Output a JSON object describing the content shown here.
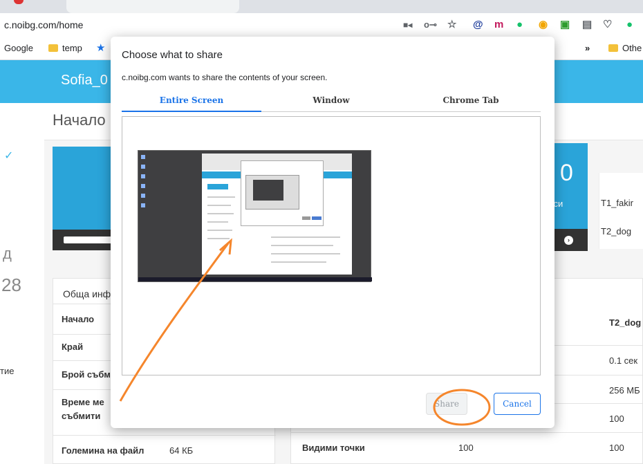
{
  "browser": {
    "url": "c.noibg.com/home",
    "bookmarks": [
      "Google",
      "temp",
      "»",
      "Othe"
    ]
  },
  "page": {
    "site_name": "Sofia_0",
    "breadcrumb": "Начало",
    "left_fragments": [
      "д",
      "28",
      "тие"
    ],
    "blue_count": "0",
    "blue_label": "роси",
    "side_items": [
      "T1_fakir",
      "T2_dog"
    ],
    "info_header": "Обща инф",
    "info_rows": [
      {
        "key": "Начало",
        "value": ""
      },
      {
        "key": "Край",
        "value": ""
      },
      {
        "key": "Брой събм",
        "value": ""
      },
      {
        "key": "Време ме",
        "key2": "събмити",
        "value": ""
      },
      {
        "key": "Големина на файл",
        "value": "64 КБ"
      }
    ],
    "right_table": {
      "header": "T2_dog",
      "rows": [
        {
          "col1": "",
          "col2": "",
          "col3": "0.1 сек"
        },
        {
          "col1": "",
          "col2": "",
          "col3": "256 МБ"
        },
        {
          "col1": "",
          "col2": "",
          "col3": "100"
        },
        {
          "col1": "Видими точки",
          "col2": "100",
          "col3": "100"
        }
      ]
    }
  },
  "dialog": {
    "title": "Choose what to share",
    "subtitle": "c.noibg.com wants to share the contents of your screen.",
    "tabs": [
      "Entire Screen",
      "Window",
      "Chrome Tab"
    ],
    "active_tab": "Entire Screen",
    "share_label": "Share",
    "cancel_label": "Cancel"
  },
  "colors": {
    "accent": "#1a73e8",
    "header_blue": "#3ab6e8",
    "annotation": "#f5862c"
  }
}
